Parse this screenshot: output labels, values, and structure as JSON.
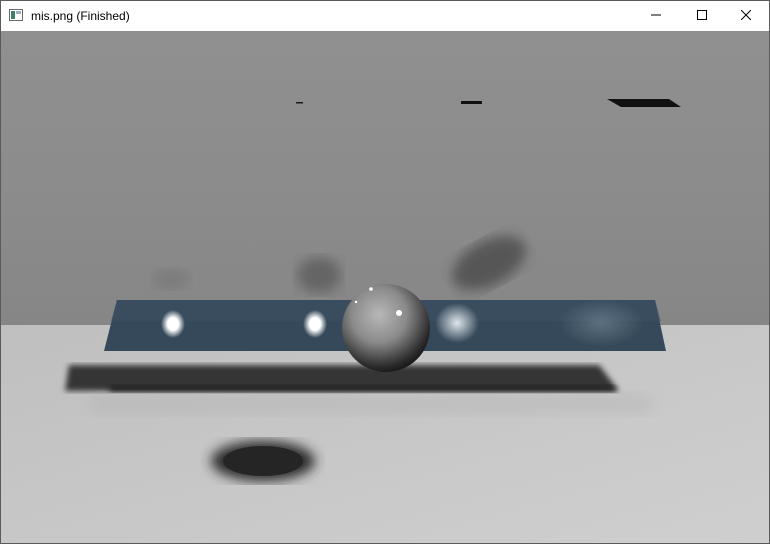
{
  "window": {
    "title": "mis.png (Finished)",
    "app_icon": "image-viewer-icon",
    "controls": {
      "minimize_icon": "minimize-icon",
      "maximize_icon": "maximize-icon",
      "close_icon": "close-icon"
    }
  },
  "scene": {
    "wall_color": "#8d8d8d",
    "floor_color": "#c8c8c8",
    "panel_color": "#35495a",
    "sphere_color": "#7a7a7a",
    "shadow_color": "#2f2f2f"
  }
}
